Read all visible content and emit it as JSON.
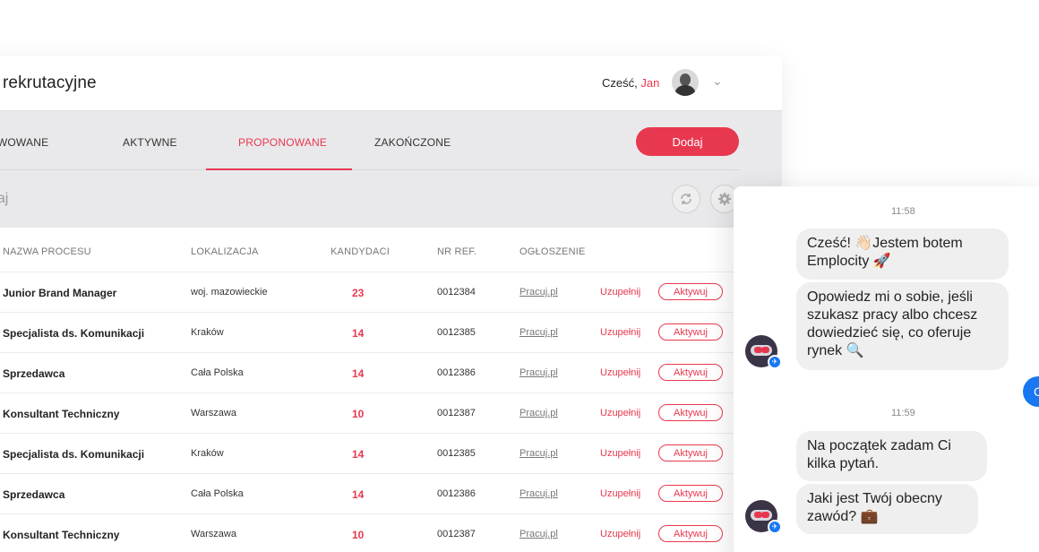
{
  "header": {
    "title": "y rekrutacyjne",
    "greeting": "Cześć,",
    "user_name": "Jan",
    "chevron": "⌄"
  },
  "tabs": [
    {
      "label": "ERWOWANE"
    },
    {
      "label": "AKTYWNE"
    },
    {
      "label": "PROPONOWANE"
    },
    {
      "label": "ZAKOŃCZONE"
    }
  ],
  "active_tab": "PROPONOWANE",
  "add_button": "Dodaj",
  "search": {
    "placeholder": "ukaj"
  },
  "table": {
    "columns": [
      "NAZWA PROCESU",
      "LOKALIZACJA",
      "KANDYDACI",
      "NR REF.",
      "OGŁOSZENIE"
    ],
    "rows": [
      {
        "name": "Junior Brand Manager",
        "location": "woj. mazowieckie",
        "candidates": "23",
        "ref": "0012384",
        "ad": "Pracuj.pl",
        "fill": "Uzupełnij",
        "action": "Aktywuj"
      },
      {
        "name": "Specjalista ds. Komunikacji",
        "location": "Kraków",
        "candidates": "14",
        "ref": "0012385",
        "ad": "Pracuj.pl",
        "fill": "Uzupełnij",
        "action": "Aktywuj"
      },
      {
        "name": "Sprzedawca",
        "location": "Cała Polska",
        "candidates": "14",
        "ref": "0012386",
        "ad": "Pracuj.pl",
        "fill": "Uzupełnij",
        "action": "Aktywuj"
      },
      {
        "name": "Konsultant Techniczny",
        "location": "Warszawa",
        "candidates": "10",
        "ref": "0012387",
        "ad": "Pracuj.pl",
        "fill": "Uzupełnij",
        "action": "Aktywuj"
      },
      {
        "name": "Specjalista ds. Komunikacji",
        "location": "Kraków",
        "candidates": "14",
        "ref": "0012385",
        "ad": "Pracuj.pl",
        "fill": "Uzupełnij",
        "action": "Aktywuj"
      },
      {
        "name": "Sprzedawca",
        "location": "Cała Polska",
        "candidates": "14",
        "ref": "0012386",
        "ad": "Pracuj.pl",
        "fill": "Uzupełnij",
        "action": "Aktywuj"
      },
      {
        "name": "Konsultant Techniczny",
        "location": "Warszawa",
        "candidates": "10",
        "ref": "0012387",
        "ad": "Pracuj.pl",
        "fill": "Uzupełnij",
        "action": "Aktywuj"
      }
    ]
  },
  "chat": {
    "time1": "11:58",
    "msg1a": "Cześć! 👋🏻Jestem botem",
    "msg1b": "Emplocity 🚀",
    "msg2a": "Opowiedz mi o sobie, jeśli",
    "msg2b": "szukasz pracy albo chcesz",
    "msg2c": "dowiedzieć się, co oferuje",
    "msg2d": "rynek 🔍",
    "time2": "11:59",
    "msg3a": "Na początek zadam Ci",
    "msg3b": "kilka pytań.",
    "msg4a": "Jaki jest Twój obecny",
    "msg4b": "zawód? 💼",
    "right_button": "C"
  },
  "colors": {
    "accent": "#e8384f",
    "messenger": "#1877f2"
  },
  "icons": [
    "refresh-icon",
    "gear-icon",
    "chevron-down-icon",
    "messenger-icon"
  ]
}
